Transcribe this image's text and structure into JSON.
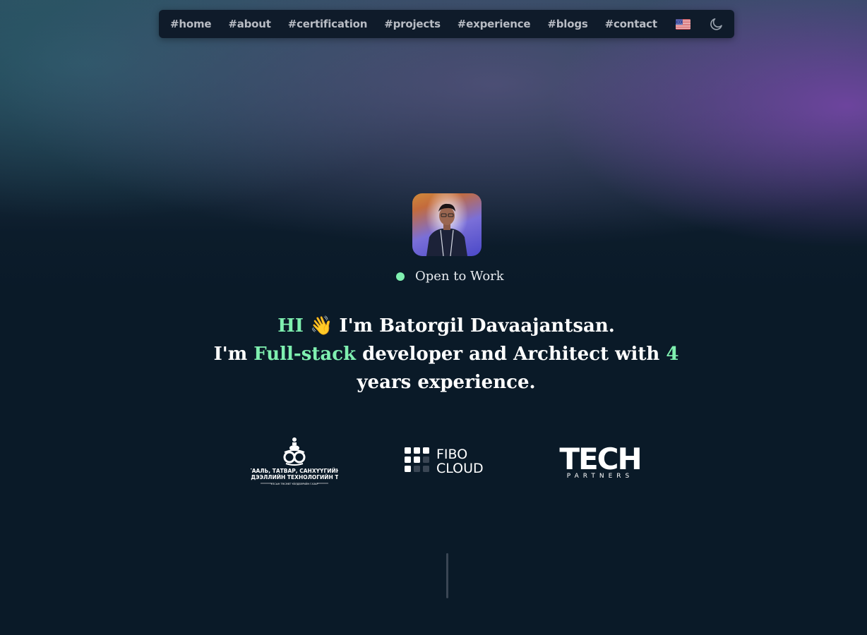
{
  "nav": {
    "links": [
      "#home",
      "#about",
      "#certification",
      "#projects",
      "#experience",
      "#blogs",
      "#contact"
    ],
    "language_icon": "us-flag-icon",
    "theme_icon": "moon-icon"
  },
  "profile": {
    "status": "Open to Work",
    "status_color": "#7ff0b0"
  },
  "hero": {
    "greeting": "HI",
    "wave": "👋",
    "intro": " I'm Batorgil Davaajantsan.",
    "line2_prefix": "I'm ",
    "role": "Full-stack",
    "line2_mid": " developer and Architect with ",
    "years": "4",
    "line2_suffix": " years experience.",
    "accent_color": "#7ff0b0"
  },
  "logos": {
    "customs": {
      "line1": "ГААЛЬ, ТАТВАР, САНХҮҮГИЙН",
      "line2": "МЭДЭЭЛЛИЙН ТЕХНОЛОГИЙН ТӨВ",
      "line3": "УЛСЫН ТӨСӨВТ ҮЙЛДВЭРИЙН ГАЗАР"
    },
    "fibo": {
      "line1": "FIBO",
      "line2": "CLOUD"
    },
    "tech": {
      "line1": "TECH",
      "line2": "PARTNERS"
    }
  }
}
